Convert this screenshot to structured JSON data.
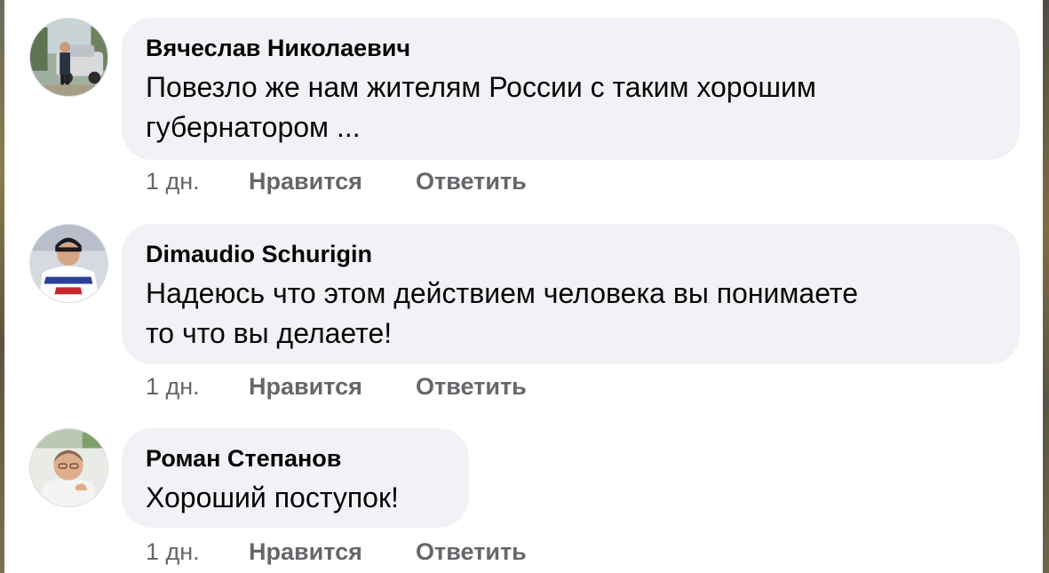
{
  "comments": [
    {
      "author": "Вячеслав Николаевич",
      "text_line1": "Повезло же нам жителям России с таким хорошим",
      "text_line2": "губернатором ...",
      "time": "1 дн.",
      "like_label": "Нравится",
      "reply_label": "Ответить"
    },
    {
      "author": "Dimaudio Schurigin",
      "text_line1": "Надеюсь что этом действием человека вы понимаете",
      "text_line2": "то что вы делаете!",
      "time": "1 дн.",
      "like_label": "Нравится",
      "reply_label": "Ответить"
    },
    {
      "author": "Роман Степанов",
      "text_line1": "Хороший поступок!",
      "time": "1 дн.",
      "like_label": "Нравится",
      "reply_label": "Ответить"
    }
  ],
  "colors": {
    "bubble": "#f0f2f5",
    "text": "#050505",
    "secondary": "#65676b"
  },
  "icons": {
    "avatar_1": "avatar-man-with-car",
    "avatar_2": "avatar-hockey-player",
    "avatar_3": "avatar-man-portrait"
  }
}
